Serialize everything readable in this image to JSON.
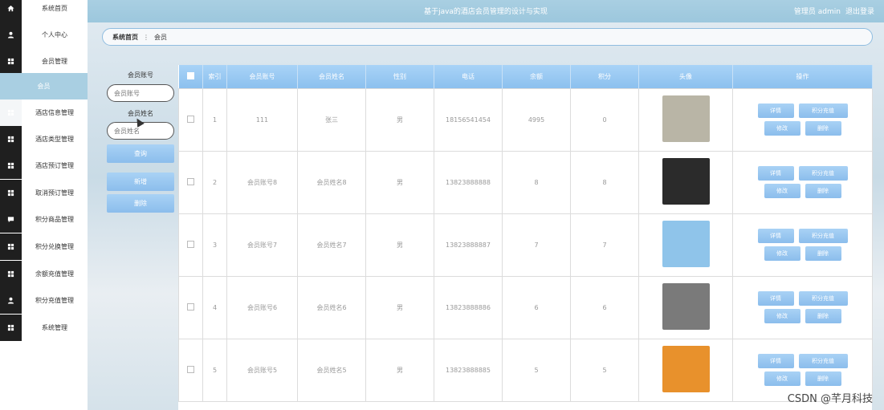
{
  "topbar": {
    "title": "基于java的酒店会员管理的设计与实现",
    "user": "管理员 admin",
    "logout": "退出登录"
  },
  "sidebar": {
    "items": [
      {
        "label": "系统首页",
        "icon": "home-icon"
      },
      {
        "label": "个人中心",
        "icon": "user-icon"
      },
      {
        "label": "会员管理",
        "icon": "grid-icon"
      },
      {
        "label": "会员",
        "icon": "",
        "sub": true
      },
      {
        "label": "酒店信息管理",
        "icon": "grid-icon"
      },
      {
        "label": "酒店类型管理",
        "icon": "grid-icon"
      },
      {
        "label": "酒店预订管理",
        "icon": "grid-icon"
      },
      {
        "label": "取消预订管理",
        "icon": "grid-icon"
      },
      {
        "label": "积分商品管理",
        "icon": "chat-icon"
      },
      {
        "label": "积分兑换管理",
        "icon": "grid-icon"
      },
      {
        "label": "余额充值管理",
        "icon": "grid-icon"
      },
      {
        "label": "积分充值管理",
        "icon": "user-icon"
      },
      {
        "label": "系统管理",
        "icon": "grid-icon"
      }
    ]
  },
  "breadcrumb": {
    "home": "系统首页",
    "sep": "⋮",
    "current": "会员"
  },
  "search": {
    "account_label": "会员账号",
    "account_placeholder": "会员账号",
    "name_label": "会员姓名",
    "name_placeholder": "会员姓名",
    "query_button": "查询",
    "add_button": "新增",
    "delete_button": "删除"
  },
  "table": {
    "headers": [
      "索引",
      "会员账号",
      "会员姓名",
      "性别",
      "电话",
      "余额",
      "积分",
      "头像",
      "操作"
    ],
    "rows": [
      {
        "index": "1",
        "account": "111",
        "name": "张三",
        "gender": "男",
        "phone": "18156541454",
        "balance": "4995",
        "points": "0",
        "avatar_color": "#b9b5a6"
      },
      {
        "index": "2",
        "account": "会员账号8",
        "name": "会员姓名8",
        "gender": "男",
        "phone": "13823888888",
        "balance": "8",
        "points": "8",
        "avatar_color": "#2b2b2b"
      },
      {
        "index": "3",
        "account": "会员账号7",
        "name": "会员姓名7",
        "gender": "男",
        "phone": "13823888887",
        "balance": "7",
        "points": "7",
        "avatar_color": "#8fc4ea"
      },
      {
        "index": "4",
        "account": "会员账号6",
        "name": "会员姓名6",
        "gender": "男",
        "phone": "13823888886",
        "balance": "6",
        "points": "6",
        "avatar_color": "#7a7a7a"
      },
      {
        "index": "5",
        "account": "会员账号5",
        "name": "会员姓名5",
        "gender": "男",
        "phone": "13823888885",
        "balance": "5",
        "points": "5",
        "avatar_color": "#e8912c"
      }
    ],
    "ops": {
      "detail": "详情",
      "points_recharge": "积分充值",
      "edit": "修改",
      "delete": "删除"
    }
  },
  "watermark": "CSDN @芊月科技"
}
